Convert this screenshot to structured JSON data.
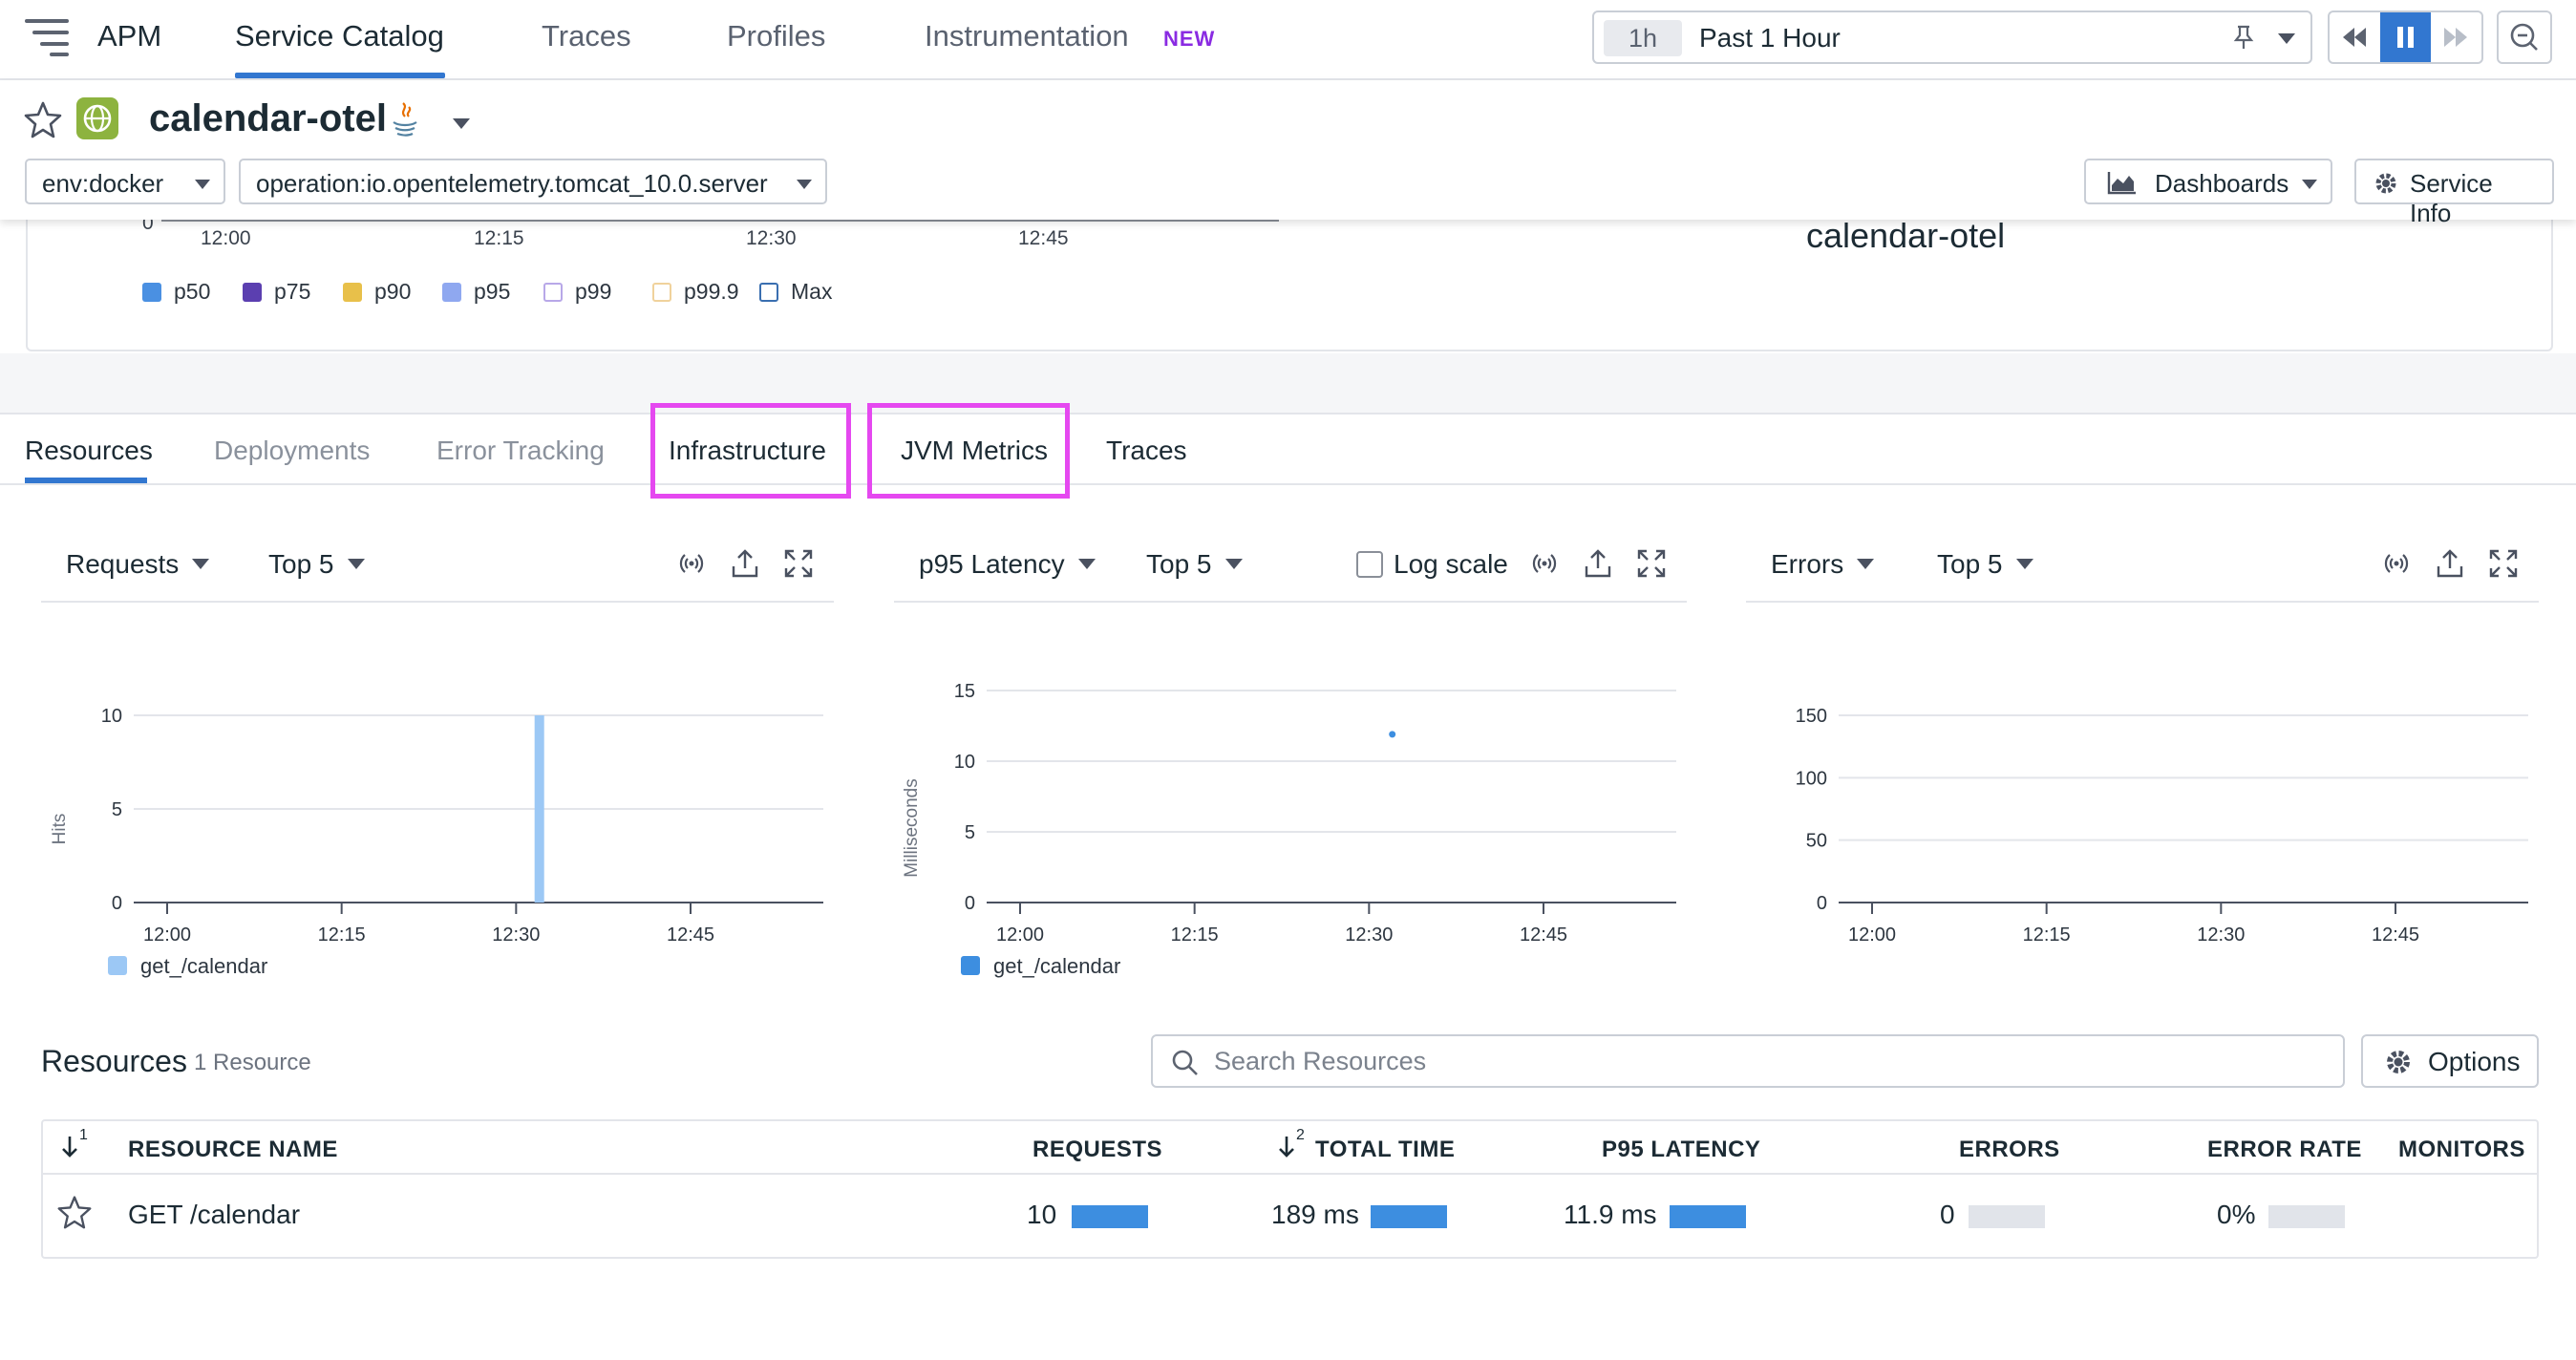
{
  "nav": {
    "app": "APM",
    "items": [
      "Service Catalog",
      "Traces",
      "Profiles",
      "Instrumentation"
    ],
    "new_badge": "NEW",
    "time_chip": "1h",
    "time_range": "Past 1 Hour"
  },
  "service": {
    "name": "calendar-otel",
    "env_filter": "env:docker",
    "operation_filter": "operation:io.opentelemetry.tomcat_10.0.server",
    "dashboards_label": "Dashboards",
    "service_info_label": "Service Info"
  },
  "upper_chart": {
    "ticks": [
      "0",
      "12:00",
      "12:15",
      "12:30",
      "12:45"
    ],
    "legend": [
      {
        "label": "p50",
        "color": "#4a90e2",
        "filled": true
      },
      {
        "label": "p75",
        "color": "#5b3fb0",
        "filled": true
      },
      {
        "label": "p90",
        "color": "#e8c04a",
        "filled": true
      },
      {
        "label": "p95",
        "color": "#8fa8f0",
        "filled": true
      },
      {
        "label": "p99",
        "color": "#b8a8e8",
        "filled": false
      },
      {
        "label": "p99.9",
        "color": "#f0d29c",
        "filled": false
      },
      {
        "label": "Max",
        "color": "#3a6fb0",
        "filled": false
      }
    ],
    "right_title": "calendar-otel"
  },
  "tabs": [
    "Resources",
    "Deployments",
    "Error Tracking",
    "Infrastructure",
    "JVM Metrics",
    "Traces"
  ],
  "panels": [
    {
      "metric": "Requests",
      "top": "Top 5",
      "ylabel": "Hits",
      "legend": "get_/calendar"
    },
    {
      "metric": "p95 Latency",
      "top": "Top 5",
      "log_scale": "Log scale",
      "ylabel": "Milliseconds",
      "legend": "get_/calendar"
    },
    {
      "metric": "Errors",
      "top": "Top 5",
      "ylabel": ""
    }
  ],
  "chart_data": [
    {
      "type": "bar",
      "title": "Requests",
      "ylabel": "Hits",
      "x_ticks": [
        "12:00",
        "12:15",
        "12:30",
        "12:45"
      ],
      "y_ticks": [
        0,
        5,
        10
      ],
      "ylim": [
        0,
        10
      ],
      "grid": true,
      "series": [
        {
          "name": "get_/calendar",
          "color": "#9cc8f5",
          "points": [
            {
              "x": "12:32",
              "y": 10
            }
          ]
        }
      ]
    },
    {
      "type": "scatter",
      "title": "p95 Latency",
      "ylabel": "Milliseconds",
      "x_ticks": [
        "12:00",
        "12:15",
        "12:30",
        "12:45"
      ],
      "y_ticks": [
        0,
        5,
        10,
        15
      ],
      "ylim": [
        0,
        15
      ],
      "grid": true,
      "series": [
        {
          "name": "get_/calendar",
          "color": "#3d8ee0",
          "points": [
            {
              "x": "12:32",
              "y": 11.9
            }
          ]
        }
      ]
    },
    {
      "type": "line",
      "title": "Errors",
      "x_ticks": [
        "12:00",
        "12:15",
        "12:30",
        "12:45"
      ],
      "y_ticks": [
        0,
        50,
        100,
        150
      ],
      "ylim": [
        0,
        150
      ],
      "grid": true,
      "series": []
    }
  ],
  "resources": {
    "title": "Resources",
    "count": "1 Resource",
    "search_placeholder": "Search Resources",
    "options_label": "Options",
    "sort1": "1",
    "sort2": "2",
    "columns": [
      "RESOURCE NAME",
      "REQUESTS",
      "TOTAL TIME",
      "P95 LATENCY",
      "ERRORS",
      "ERROR RATE",
      "MONITORS"
    ],
    "rows": [
      {
        "name": "GET /calendar",
        "requests": "10",
        "total_time": "189 ms",
        "p95": "11.9 ms",
        "errors": "0",
        "error_rate": "0%"
      }
    ]
  }
}
